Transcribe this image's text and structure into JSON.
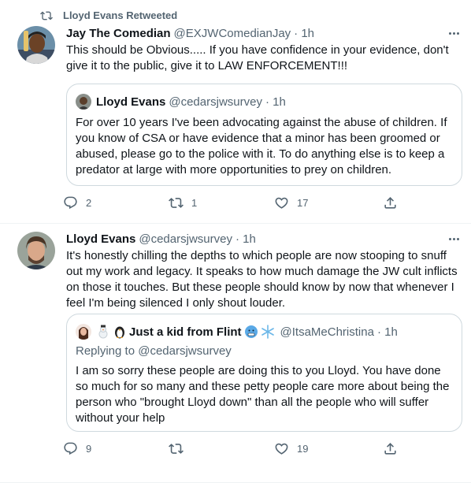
{
  "tweets": [
    {
      "retweeted_by": "Lloyd Evans Retweeted",
      "author_name": "Jay The Comedian",
      "author_handle": "@EXJWComedianJay",
      "time": "· 1h",
      "text": "This should be Obvious..... If you have confidence in your evidence, don't give it to the public, give it to LAW ENFORCEMENT!!!",
      "quoted": {
        "author_name": "Lloyd Evans",
        "author_handle": "@cedarsjwsurvey",
        "time": "· 1h",
        "text": "For over 10 years I've been advocating against the abuse of children. If you know of CSA or have evidence that a minor has been groomed or abused, please go to the police with it. To do anything else is to keep a predator at large with more opportunities to prey on children."
      },
      "actions": {
        "replies": "2",
        "retweets": "1",
        "likes": "17"
      }
    },
    {
      "author_name": "Lloyd Evans",
      "author_handle": "@cedarsjwsurvey",
      "time": "· 1h",
      "text": "It's honestly chilling the depths to which people are now stooping to snuff out my work and legacy. It speaks to how much damage the JW cult inflicts on those it touches. But these people should know by now that whenever I feel I'm being silenced I only shout louder.",
      "quoted": {
        "author_name": "Just a kid from Flint",
        "author_handle": "@ItsaMeChristina",
        "time": "· 1h",
        "replying_to": "Replying to @cedarsjwsurvey",
        "text": "I am so sorry these people are doing this to you Lloyd. You have done so much for so many and these petty people care more about being the person who \"brought Lloyd down\" than all the people who will suffer without your help"
      },
      "actions": {
        "replies": "9",
        "retweets": "",
        "likes": "19"
      }
    }
  ],
  "icons": [
    "retweet-icon",
    "more-icon",
    "reply-icon",
    "like-icon",
    "share-icon",
    "snowman-emoji",
    "penguin-emoji",
    "cold-face-emoji",
    "snowflake-emoji"
  ],
  "colors": {
    "text": "#0f1419",
    "secondary": "#536471",
    "border": "#cfd9de",
    "divider": "#eff3f4",
    "background": "#ffffff"
  }
}
